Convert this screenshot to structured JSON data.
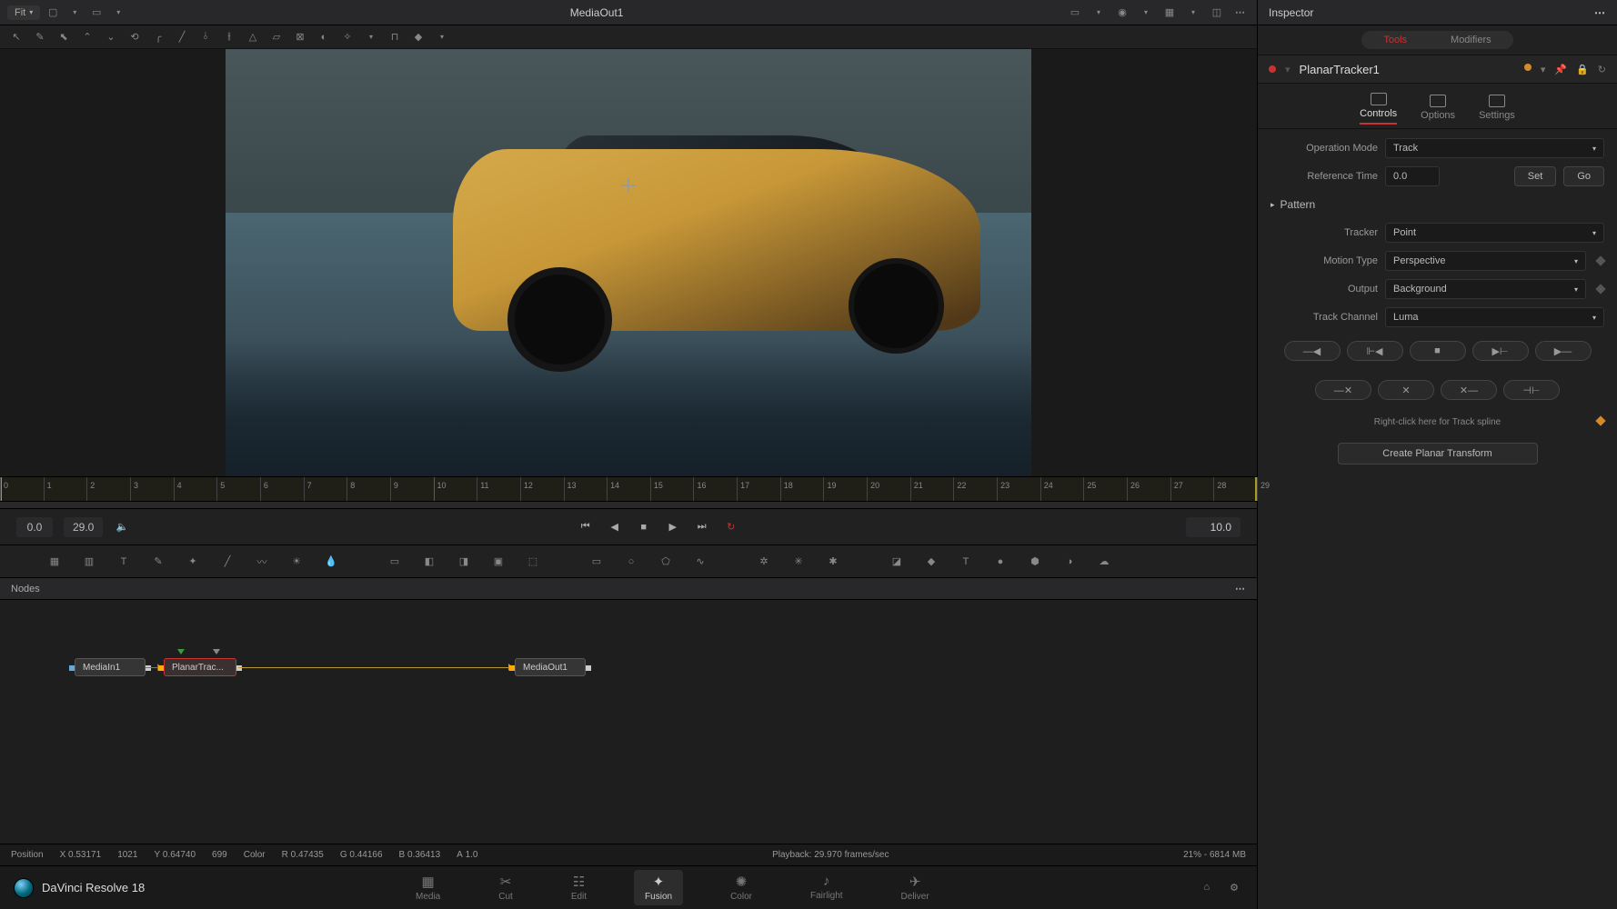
{
  "topbar": {
    "fit_label": "Fit",
    "title": "MediaOut1"
  },
  "inspector_title": "Inspector",
  "inspector_tabs": {
    "tools": "Tools",
    "modifiers": "Modifiers"
  },
  "node_name": "PlanarTracker1",
  "sub_tabs": {
    "controls": "Controls",
    "options": "Options",
    "settings": "Settings"
  },
  "props": {
    "operation_mode": {
      "label": "Operation Mode",
      "value": "Track"
    },
    "reference_time": {
      "label": "Reference Time",
      "value": "0.0",
      "set": "Set",
      "go": "Go"
    },
    "pattern_label": "Pattern",
    "tracker": {
      "label": "Tracker",
      "value": "Point"
    },
    "motion_type": {
      "label": "Motion Type",
      "value": "Perspective"
    },
    "output": {
      "label": "Output",
      "value": "Background"
    },
    "track_channel": {
      "label": "Track Channel",
      "value": "Luma"
    },
    "spline_hint": "Right-click here for Track spline",
    "create_transform": "Create Planar Transform"
  },
  "ruler": {
    "ticks": [
      "0",
      "1",
      "2",
      "3",
      "4",
      "5",
      "6",
      "7",
      "8",
      "9",
      "10",
      "11",
      "12",
      "13",
      "14",
      "15",
      "16",
      "17",
      "18",
      "19",
      "20",
      "21",
      "22",
      "23",
      "24",
      "25",
      "26",
      "27",
      "28",
      "29"
    ],
    "playhead_at": 10
  },
  "transport": {
    "in": "0.0",
    "out": "29.0",
    "current": "10.0"
  },
  "nodes_panel": {
    "title": "Nodes"
  },
  "flow": {
    "mediain": "MediaIn1",
    "planar": "PlanarTrac...",
    "mediaout": "MediaOut1"
  },
  "status": {
    "pos_label": "Position",
    "x_label": "X",
    "x": "0.53171",
    "xi": "1021",
    "y_label": "Y",
    "y": "0.64740",
    "yi": "699",
    "color_label": "Color",
    "r_label": "R",
    "r": "0.47435",
    "g_label": "G",
    "g": "0.44166",
    "b_label": "B",
    "b": "0.36413",
    "a_label": "A",
    "a": "1.0",
    "playback": "Playback: 29.970 frames/sec",
    "mem": "21% - 6814 MB"
  },
  "pages": {
    "media": "Media",
    "cut": "Cut",
    "edit": "Edit",
    "fusion": "Fusion",
    "color": "Color",
    "fairlight": "Fairlight",
    "deliver": "Deliver"
  },
  "app_name": "DaVinci Resolve 18"
}
